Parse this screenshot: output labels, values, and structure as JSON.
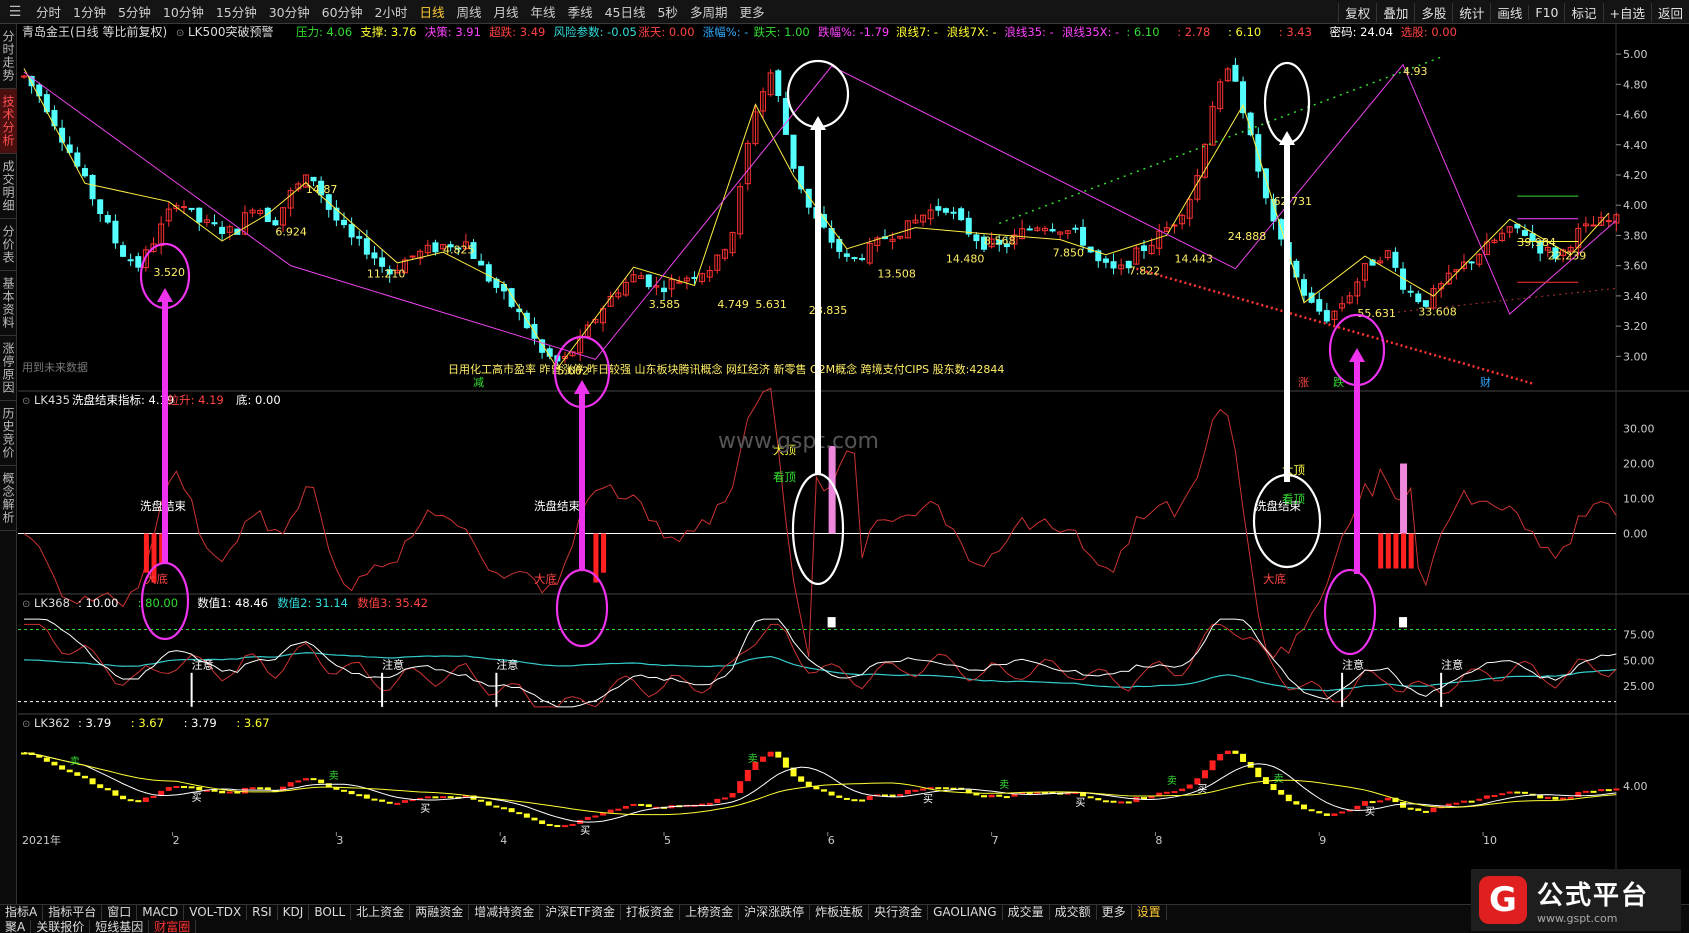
{
  "topbar": {
    "timeframes": [
      "分时",
      "1分钟",
      "5分钟",
      "10分钟",
      "15分钟",
      "30分钟",
      "60分钟",
      "2小时",
      "日线",
      "周线",
      "月线",
      "年线",
      "季线",
      "45日线",
      "5秒",
      "多周期",
      "更多"
    ],
    "active_index": 8,
    "right_buttons": [
      "复权",
      "叠加",
      "多股",
      "统计",
      "画线",
      "F10",
      "标记",
      "+自选",
      "返回"
    ]
  },
  "left_nav": [
    "分时走势",
    "技术分析",
    "成交明细",
    "分价表",
    "基本资料",
    "涨停原因",
    "历史竞价",
    "概念解析"
  ],
  "panel1": {
    "title": "青岛金王(日线 等比前复权)",
    "indicator": "LK500突破预警",
    "params": [
      {
        "text": "压力: 4.06",
        "color": "#33dd33"
      },
      {
        "text": "支撑: 3.76",
        "color": "#ffff33"
      },
      {
        "text": "决策: 3.91",
        "color": "#ff44ff"
      },
      {
        "text": "超跌: 3.49",
        "color": "#ff4444"
      },
      {
        "text": "风险参数: -0.05",
        "color": "#33dddd"
      },
      {
        "text": "涨天: 0.00",
        "color": "#ff4444"
      },
      {
        "text": "涨幅%: -",
        "color": "#33aaff"
      },
      {
        "text": "跌天: 1.00",
        "color": "#33dd33"
      },
      {
        "text": "跌幅%: -1.79",
        "color": "#ff44ff"
      },
      {
        "text": "浪线7: -",
        "color": "#ffff33"
      },
      {
        "text": "浪线7X: -",
        "color": "#ffff33"
      },
      {
        "text": "浪线35: -",
        "color": "#ff44ff"
      },
      {
        "text": "浪线35X: -",
        "color": "#ff44ff"
      },
      {
        "text": ": 6.10",
        "color": "#33dd33"
      },
      {
        "text": ": 2.78",
        "color": "#ff4444"
      },
      {
        "text": ": 6.10",
        "color": "#ffff33"
      },
      {
        "text": ": 3.43",
        "color": "#ff4444"
      },
      {
        "text": "密码: 24.04",
        "color": "#ffffff"
      },
      {
        "text": "选股: 0.00",
        "color": "#ff4444"
      }
    ],
    "y_ticks": [
      "5.00",
      "4.80",
      "4.60",
      "4.40",
      "4.20",
      "4.00",
      "3.80",
      "3.60",
      "3.40",
      "3.20",
      "3.00"
    ],
    "wave_labels": [
      "3.520",
      "6.924",
      "14.87",
      "11.210",
      "4.825",
      "5.602",
      "3.585",
      "4.749",
      "5.631",
      "28.835",
      "13.508",
      "14.480",
      "8.568",
      "7.850",
      "7.822",
      "14.443",
      "24.888",
      "62.731",
      "4.93",
      "55.631",
      "33.608",
      "39.984",
      "22.239"
    ],
    "concept_text": "日用化工高市盈率 昨曾涨停 昨日较强 山东板块腾讯概念 网红经济 新零售 O2M概念 跨境支付CIPS 股东数:42844",
    "no_future": "用到未来数据",
    "markers": [
      "减",
      "涨",
      "跌",
      "财"
    ]
  },
  "panel2": {
    "indicator": "LK435",
    "params": [
      {
        "text": "洗盘结束指标: 4.19",
        "color": "#ffffff"
      },
      {
        "text": "拉升: 4.19",
        "color": "#ff4444"
      },
      {
        "text": "底: 0.00",
        "color": "#ffffff"
      }
    ],
    "y_ticks": [
      "30.00",
      "20.00",
      "10.00",
      "0.00"
    ],
    "labels": [
      "洗盘结束",
      "洗盘结束",
      "洗盘结束",
      "大底",
      "大底",
      "大底",
      "大顶",
      "大顶",
      "看顶",
      "看顶"
    ],
    "watermark": "www.gspt.com"
  },
  "panel3": {
    "indicator": "LK368",
    "params": [
      {
        "text": ": 10.00",
        "color": "#ffffff"
      },
      {
        "text": ": 80.00",
        "color": "#33dd33"
      },
      {
        "text": "数值1: 48.46",
        "color": "#ffffff"
      },
      {
        "text": "数值2: 31.14",
        "color": "#33dddd"
      },
      {
        "text": "数值3: 35.42",
        "color": "#ff4444"
      }
    ],
    "y_ticks": [
      "75.00",
      "50.00",
      "25.00"
    ],
    "notice": "注意"
  },
  "panel4": {
    "indicator": "LK362",
    "params": [
      {
        "text": ": 3.79",
        "color": "#ffffff"
      },
      {
        "text": ": 3.67",
        "color": "#ffff33"
      },
      {
        "text": ": 3.79",
        "color": "#ffffff"
      },
      {
        "text": ": 3.67",
        "color": "#ffff33"
      }
    ],
    "y_ticks": [
      "4.00"
    ],
    "buy": "买",
    "sell": "卖"
  },
  "x_axis": [
    "2021年",
    "2",
    "3",
    "4",
    "5",
    "6",
    "7",
    "8",
    "9",
    "10"
  ],
  "bottom_tabs_row1": [
    "指标A",
    "指标平台",
    "窗口",
    "MACD",
    "VOL-TDX",
    "RSI",
    "KDJ",
    "BOLL",
    "北上资金",
    "两融资金",
    "增减持资金",
    "沪深ETF资金",
    "打板资金",
    "上榜资金",
    "沪深涨跌停",
    "炸板连板",
    "央行资金",
    "GAOLIANG",
    "成交量",
    "成交额",
    "更多",
    "设置"
  ],
  "bottom_tabs_row2": [
    "聚A",
    "关联报价",
    "短线基因",
    "财富圈"
  ],
  "logo": {
    "mark": "G",
    "name": "公式平台",
    "url": "www.gspt.com"
  },
  "colors": {
    "up": "#ff3232",
    "down": "#54ffff",
    "yellow": "#ffff33",
    "magenta": "#ff44ff",
    "white": "#ffffff",
    "green": "#33dd33"
  },
  "chart_data": {
    "type": "candlestick",
    "x": [
      "2021-01",
      "2021-02",
      "2021-03",
      "2021-04",
      "2021-05",
      "2021-06",
      "2021-07",
      "2021-08",
      "2021-09",
      "2021-10"
    ],
    "close_path": [
      4.85,
      4.7,
      4.45,
      4.2,
      3.95,
      3.7,
      3.6,
      3.82,
      4.05,
      3.9,
      3.85,
      3.82,
      4.02,
      3.88,
      4.1,
      4.2,
      3.95,
      3.78,
      3.7,
      3.55,
      3.65,
      3.7,
      3.74,
      3.76,
      3.55,
      3.4,
      3.25,
      3.02,
      2.95,
      3.1,
      3.3,
      3.45,
      3.55,
      3.45,
      3.5,
      3.55,
      3.6,
      3.85,
      4.6,
      4.9,
      4.3,
      3.95,
      3.78,
      3.62,
      3.7,
      3.8,
      3.85,
      3.95,
      4.0,
      3.85,
      3.75,
      3.72,
      3.82,
      3.88,
      3.85,
      3.8,
      3.62,
      3.55,
      3.68,
      3.78,
      3.9,
      4.1,
      4.7,
      4.93,
      4.4,
      3.9,
      3.6,
      3.35,
      3.25,
      3.4,
      3.6,
      3.7,
      3.45,
      3.35,
      3.48,
      3.6,
      3.7,
      3.8,
      3.85,
      3.72,
      3.66,
      3.82,
      3.88,
      3.9
    ]
  }
}
